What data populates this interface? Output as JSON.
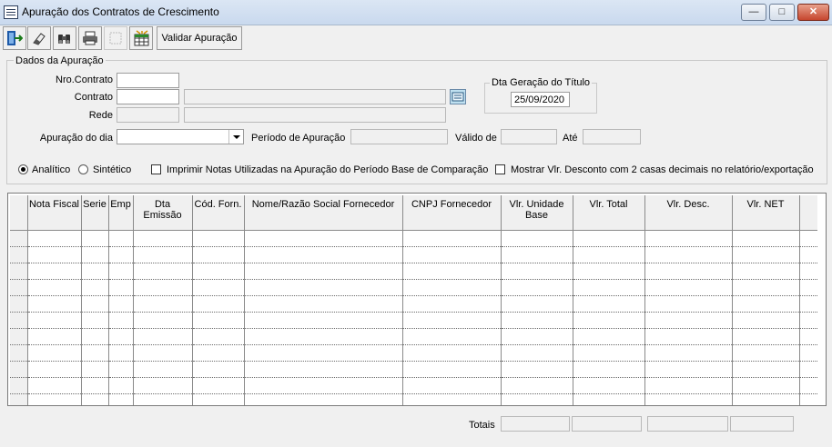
{
  "window": {
    "title": "Apuração dos Contratos de Crescimento",
    "minimize_glyph": "—",
    "maximize_glyph": "□",
    "close_glyph": "✕"
  },
  "toolbar": {
    "buttons": [
      {
        "icon": "exit-door-icon"
      },
      {
        "icon": "eraser-icon"
      },
      {
        "icon": "binoculars-icon"
      },
      {
        "icon": "printer-icon"
      },
      {
        "icon": "disabled-blank-icon"
      },
      {
        "icon": "grid-export-icon"
      }
    ],
    "validate_label": "Validar Apuração"
  },
  "form": {
    "group_title": "Dados da Apuração",
    "nro_contrato_label": "Nro.Contrato",
    "contrato_label": "Contrato",
    "rede_label": "Rede",
    "apuracao_dia_label": "Apuração do dia",
    "periodo_label": "Período de Apuração",
    "valido_de_label": "Válido de",
    "ate_label": "Até",
    "dta_geracao_group_title": "Dta Geração do Título",
    "dta_geracao_value": "25/09/2020",
    "nro_contrato_value": "",
    "contrato_value": "",
    "contrato_desc_value": "",
    "rede_value": "",
    "rede_desc_value": "",
    "apuracao_dia_value": "",
    "periodo_value": "",
    "valido_de_value": "",
    "ate_value": ""
  },
  "options": {
    "analitico_label": "Analítico",
    "analitico_selected": true,
    "sintetico_label": "Sintético",
    "sintetico_selected": false,
    "imprimir_notas_label": "Imprimir Notas Utilizadas na Apuração do Período Base de Comparação",
    "imprimir_notas_checked": false,
    "mostrar_vlr_label": "Mostrar Vlr. Desconto com 2 casas decimais no relatório/exportação",
    "mostrar_vlr_checked": false
  },
  "grid": {
    "columns": [
      "Nota Fiscal",
      "Serie",
      "Emp",
      "Dta Emissão",
      "Cód. Forn.",
      "Nome/Razão Social Fornecedor",
      "CNPJ Fornecedor",
      "Vlr. Unidade Base",
      "Vlr. Total",
      "Vlr. Desc.",
      "Vlr. NET"
    ],
    "row_count": 11
  },
  "totals": {
    "label": "Totais",
    "values": [
      "",
      "",
      "",
      ""
    ]
  }
}
